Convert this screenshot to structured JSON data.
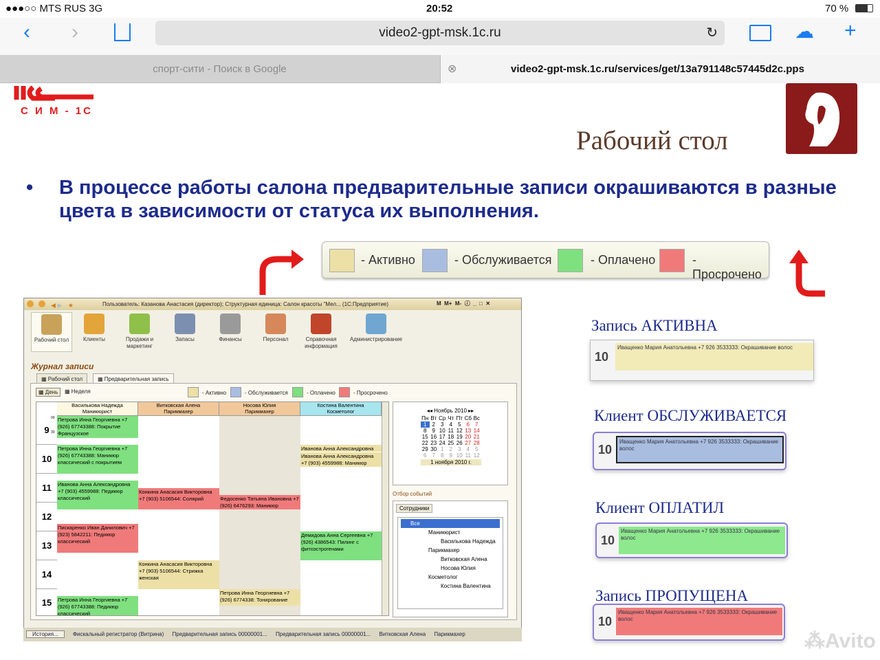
{
  "status": {
    "carrier": "●●●○○ MTS RUS  3G",
    "time": "20:52",
    "battery": "70 %"
  },
  "browser": {
    "url": "video2-gpt-msk.1c.ru",
    "tabs": [
      {
        "label": "спорт-сити - Поиск в Google"
      },
      {
        "label": "video2-gpt-msk.1c.ru/services/get/13a791148c57445d2c.pps"
      }
    ]
  },
  "slide": {
    "logo_text": "С И М - 1С",
    "title": "Рабочий стол",
    "bullet": "В процессе работы салона предварительные записи окрашиваются в разные цвета в зависимости от статуса их выполнения.",
    "legend": [
      {
        "label": "- Активно",
        "color": "#ede0a6"
      },
      {
        "label": "- Обслуживается",
        "color": "#a9bde0"
      },
      {
        "label": "- Оплачено",
        "color": "#7fe07f"
      },
      {
        "label": "- Просрочено",
        "color": "#f07a7a"
      }
    ]
  },
  "app": {
    "title": "Пользователь: Казанова Анастасия (директор); Структурная единица: Салон красоты \"Мел... (1С:Предприятие)",
    "title_buttons": [
      "M",
      "M+",
      "M-"
    ],
    "toolbar": [
      "Рабочий стол",
      "Клиенты",
      "Продажи и маркетинг",
      "Запасы",
      "Финансы",
      "Персонал",
      "Справочная информация",
      "Администрирование"
    ],
    "journal_title": "Журнал записи",
    "tabs": [
      "Рабочий стол",
      "Предварительная запись"
    ],
    "view_buttons": [
      "День",
      "Неделя"
    ],
    "legend": [
      "- Активно",
      "- Обслуживается",
      "- Оплачено",
      "- Просрочено"
    ],
    "columns": [
      {
        "name": "Василькова Надежда",
        "role": "Маникюрист"
      },
      {
        "name": "Витковская Алена",
        "role": "Парикмахер"
      },
      {
        "name": "Носова Юлия",
        "role": "Парикмахер"
      },
      {
        "name": "Костина Валентина",
        "role": "Косметолог"
      }
    ],
    "hours": [
      "9",
      "10",
      "11",
      "12",
      "13",
      "14",
      "15"
    ],
    "minutes": [
      "00",
      "30"
    ],
    "entries": [
      {
        "text": "Петрова Инна Георгиевна +7 (926) 67743388: Покрытие Французское"
      },
      {
        "text": "Петрова Инна Георгиевна +7 (926) 67743388: Маникюр классический с покрытием"
      },
      {
        "text": "Иванова Анна Александровна"
      },
      {
        "text": "Иванова Анна Александровна +7 (903) 4559988: Маникюр"
      },
      {
        "text": "Иванова Анна Александровна +7 (903) 4559988: Педикюр классический"
      },
      {
        "text": "Конкина Анасасия Викторовна +7 (903) 5106544: Солярий"
      },
      {
        "text": "Федосенко Татьяна Ивановна +7 (926) 6476293: Маникюр"
      },
      {
        "text": "Пискаренко Иван Данилович +7 (923) 5842211: Педикюр классический"
      },
      {
        "text": "Демидова Анна Сергеевна +7 (926) 4386543: Пилинг с фитоэстрогенами"
      },
      {
        "text": "Конкина Анасасия Викторовна +7 (903) 5106544: Стрижка женская"
      },
      {
        "text": "Петрова Инна Георгиевна +7 (926) 67743388: Педикюр классический"
      },
      {
        "text": "Петрова Инна Георгиевна +7 (926) 6774338: Тонирование"
      }
    ],
    "calendar": {
      "month": "Ноябрь 2010",
      "weekdays": [
        "Пн",
        "Вт",
        "Ср",
        "Чт",
        "Пт",
        "Сб",
        "Вс"
      ],
      "rows": [
        [
          "1",
          "2",
          "3",
          "4",
          "5",
          "6",
          "7"
        ],
        [
          "8",
          "9",
          "10",
          "11",
          "12",
          "13",
          "14"
        ],
        [
          "15",
          "16",
          "17",
          "18",
          "19",
          "20",
          "21"
        ],
        [
          "22",
          "23",
          "24",
          "25",
          "26",
          "27",
          "28"
        ],
        [
          "29",
          "30",
          "1",
          "2",
          "3",
          "4",
          "5"
        ],
        [
          "6",
          "7",
          "8",
          "9",
          "10",
          "11",
          "12"
        ]
      ],
      "selected": "1 ноября 2010 г."
    },
    "filter_title": "Отбор событий",
    "filter_tab": "Сотрудники",
    "tree": [
      "Все",
      "Маникюрист",
      "Василькова Надежда",
      "Парикмахер",
      "Витковская Алена",
      "Носова Юлия",
      "Косметолог",
      "Костина Валентина"
    ],
    "taskbar": [
      "История...",
      "Фискальный регистратор (Витрина)",
      "Предварительная запись 00000001...",
      "Предварительная запись 00000001...",
      "Витковская Алена",
      "Парикмахер"
    ]
  },
  "examples": [
    {
      "label": "Запись АКТИВНА",
      "num": "10",
      "text": "Иващенко Мария Анатольевна +7 926 3533333: Окрашивание волос",
      "color": "#ede0a6"
    },
    {
      "label": "Клиент ОБСЛУЖИВАЕТСЯ",
      "num": "10",
      "text": "Иващенко Мария Анатольевна +7 926 3533333: Окрашивание волос",
      "color": "#a9bde0"
    },
    {
      "label": "Клиент ОПЛАТИЛ",
      "num": "10",
      "text": "Иващенко Мария Анатольевна +7 926 3533333: Окрашивание волос",
      "color": "#8ee88e"
    },
    {
      "label": "Запись ПРОПУЩЕНА",
      "num": "10",
      "text": "Иващенко Мария Анатольевна +7 926 3533333: Окрашивание волос",
      "color": "#f07a7a"
    }
  ],
  "watermark": "Avito"
}
